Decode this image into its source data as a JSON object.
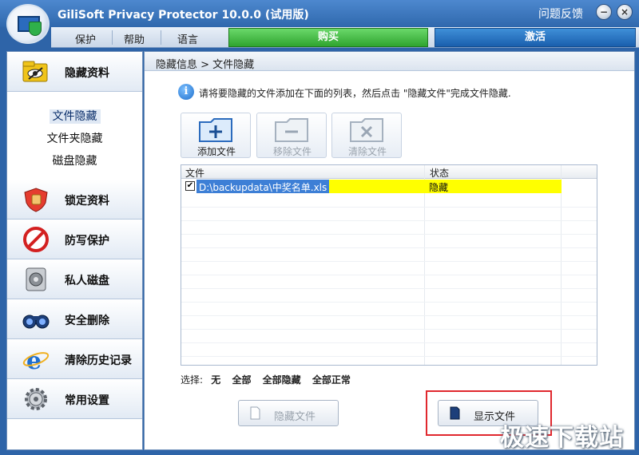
{
  "app": {
    "title": "GiliSoft Privacy Protector 10.0.0 (试用版)",
    "feedback": "问题反馈",
    "minimize_glyph": "−",
    "close_glyph": "×"
  },
  "menu": {
    "protect": "保护",
    "help": "帮助",
    "language": "语言",
    "buy": "购买",
    "activate": "激活"
  },
  "sidebar": {
    "categories": [
      {
        "label": "隐藏资料",
        "icon": "hide-data-icon"
      },
      {
        "label": "锁定资料",
        "icon": "lock-data-icon"
      },
      {
        "label": "防写保护",
        "icon": "write-protect-icon"
      },
      {
        "label": "私人磁盘",
        "icon": "private-disk-icon"
      },
      {
        "label": "安全删除",
        "icon": "secure-delete-icon"
      },
      {
        "label": "清除历史记录",
        "icon": "clear-history-icon"
      },
      {
        "label": "常用设置",
        "icon": "settings-icon"
      }
    ],
    "sub_items": [
      "文件隐藏",
      "文件夹隐藏",
      "磁盘隐藏"
    ]
  },
  "main": {
    "breadcrumb": "隐藏信息 > 文件隐藏",
    "info_text": "请将要隐藏的文件添加在下面的列表，然后点击 \"隐藏文件\"完成文件隐藏.",
    "toolbar": {
      "add": "添加文件",
      "remove": "移除文件",
      "clear": "清除文件"
    },
    "table": {
      "columns": [
        "文件",
        "状态"
      ],
      "rows": [
        {
          "file": "D:\\backupdata\\中奖名单.xls",
          "status": "隐藏",
          "checked": "✔"
        }
      ]
    },
    "select": {
      "label": "选择:",
      "none": "无",
      "all": "全部",
      "all_hidden": "全部隐藏",
      "all_normal": "全部正常"
    },
    "hide_button": "隐藏文件",
    "show_button": "显示文件"
  },
  "watermark": "极速下载站"
}
